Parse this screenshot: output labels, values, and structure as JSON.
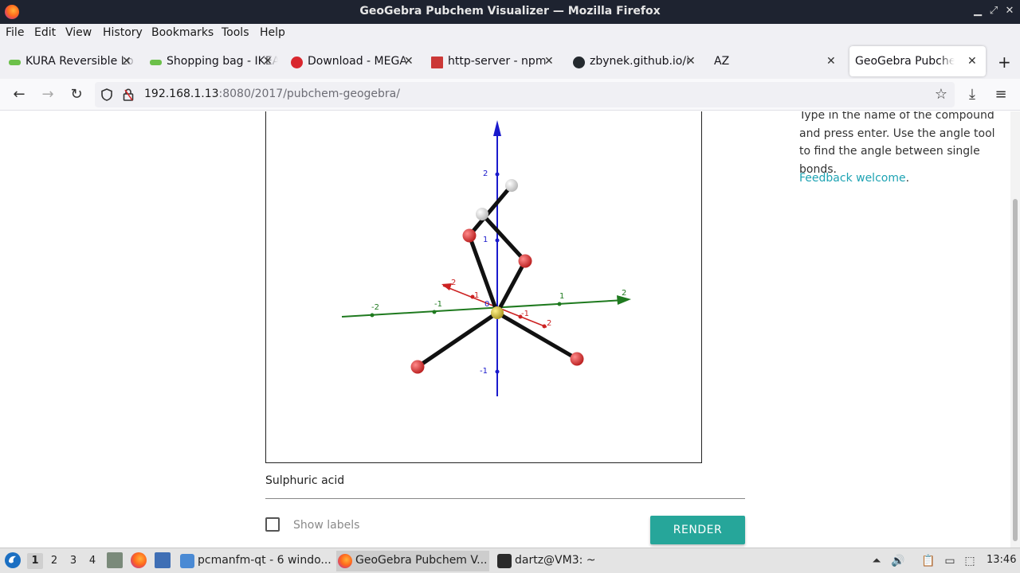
{
  "window": {
    "title": "GeoGebra Pubchem Visualizer — Mozilla Firefox"
  },
  "menu": [
    "File",
    "Edit",
    "View",
    "History",
    "Bookmarks",
    "Tools",
    "Help"
  ],
  "tabs": [
    {
      "label": "KURA Reversible Lo",
      "favicon_color": "#6cc04a"
    },
    {
      "label": "Shopping bag - IKEA",
      "favicon_color": "#6cc04a"
    },
    {
      "label": "Download - MEGA",
      "favicon_color": "#d9272e"
    },
    {
      "label": "http-server - npm",
      "favicon_color": "#cb3837"
    },
    {
      "label": "zbynek.github.io/i",
      "favicon_color": "#24292e"
    },
    {
      "label": "AZ",
      "favicon_color": "#f0f0f4"
    },
    {
      "label": "GeoGebra Pubchem Vi",
      "favicon_color": "#ffffff",
      "active": true
    }
  ],
  "address": {
    "host": "192.168.1.13",
    "path": ":8080/2017/pubchem-geogebra/"
  },
  "page": {
    "instructions": "Type in the name of the compound and press enter. Use the angle tool to find the angle between single bonds.",
    "feedback_link": "Feedback welcome",
    "feedback_suffix": ".",
    "compound_value": "Sulphuric acid",
    "show_labels": "Show labels",
    "render_button": "RENDER",
    "colors": {
      "accent": "#26a69a",
      "link": "#1ea3b3"
    }
  },
  "graph": {
    "axis_ticks": {
      "z": [
        "2",
        "1",
        "-1"
      ],
      "y": [
        "-2",
        "-1",
        "1",
        "2"
      ],
      "x": [
        "2",
        "1",
        "-1",
        "2"
      ],
      "origin": "0"
    },
    "atoms": [
      {
        "name": "sulfur-atom",
        "color": "#d4c23a"
      },
      {
        "name": "oxygen-atom",
        "color": "#d42a2a"
      },
      {
        "name": "hydrogen-atom",
        "color": "#d8d8d8"
      }
    ]
  },
  "taskbar": {
    "workspaces": [
      "1",
      "2",
      "3",
      "4"
    ],
    "tasks": [
      {
        "label": "pcmanfm-qt - 6 windo..."
      },
      {
        "label": "GeoGebra Pubchem V..."
      },
      {
        "label": "dartz@VM3: ~"
      }
    ],
    "clock": "13:46"
  }
}
